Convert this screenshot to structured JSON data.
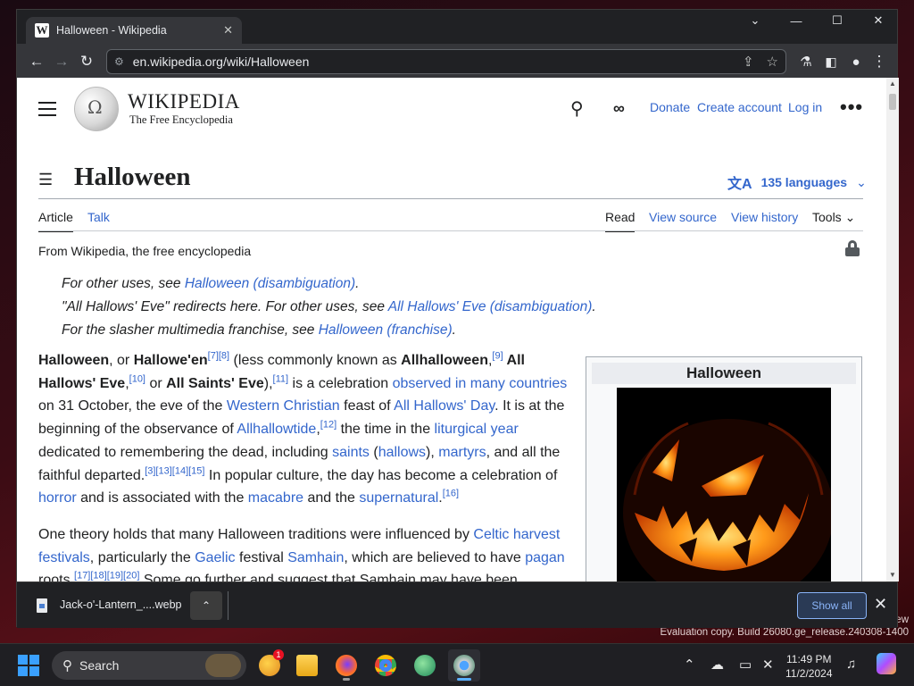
{
  "browser": {
    "tab_title": "Halloween - Wikipedia",
    "tab_close": "✕",
    "url": "en.wikipedia.org/wiki/Halloween",
    "window_controls": [
      "⌄",
      "—",
      "☐",
      "✕"
    ]
  },
  "wiki": {
    "wordmark": "WIKIPEDIA",
    "tagline": "The Free Encyclopedia",
    "donate": "Donate",
    "create_account": "Create account",
    "log_in": "Log in",
    "page_title": "Halloween",
    "languages": "135 languages",
    "tabs": {
      "article": "Article",
      "talk": "Talk",
      "read": "Read",
      "view_source": "View source",
      "view_history": "View history",
      "tools": "Tools"
    },
    "from_wikipedia": "From Wikipedia, the free encyclopedia",
    "hatnotes": [
      {
        "prefix": "For other uses, see ",
        "link": "Halloween (disambiguation)",
        "suffix": "."
      },
      {
        "prefix": "\"All Hallows' Eve\" redirects here. For other uses, see ",
        "link": "All Hallows' Eve (disambiguation)",
        "suffix": "."
      },
      {
        "prefix": "For the slasher multimedia franchise, see ",
        "link": "Halloween (franchise)",
        "suffix": "."
      }
    ],
    "infobox_title": "Halloween",
    "p1": {
      "t1": "Halloween",
      "t2": ", or ",
      "t3": "Hallowe'en",
      "s1": "[7][8]",
      "t4": " (less commonly known as ",
      "t5": "Allhalloween",
      "t6": ",",
      "s2": "[9]",
      "t7": " All Hallows' Eve",
      "t8": ",",
      "s3": "[10]",
      "t9": " or ",
      "t10": "All Saints' Eve",
      "t11": ")",
      "t12": ",",
      "s4": "[11]",
      "t13": " is a celebration ",
      "l1": "observed in many countries",
      "t14": " on 31 October, the eve of the ",
      "l2": "Western Christian",
      "t15": " feast of ",
      "l3": "All Hallows' Day",
      "t16": ". It is at the beginning of the observance of ",
      "l4": "Allhallowtide",
      "t17": ",",
      "s5": "[12]",
      "t18": " the time in the ",
      "l5": "liturgical year",
      "t19": " dedicated to remembering the dead, including ",
      "l6": "saints",
      "t20": " (",
      "l7": "hallows",
      "t21": "), ",
      "l8": "martyrs",
      "t22": ", and all the faithful departed.",
      "s6": "[3][13][14][15]",
      "t23": " In popular culture, the day has become a celebration of ",
      "l9": "horror",
      "t24": " and is associated with the ",
      "l10": "macabre",
      "t25": " and the ",
      "l11": "supernatural",
      "t26": ".",
      "s7": "[16]"
    },
    "p2": {
      "t1": "One theory holds that many Halloween traditions were influenced by ",
      "l1": "Celtic harvest festivals",
      "t2": ", particularly the ",
      "l2": "Gaelic",
      "t3": " festival ",
      "l3": "Samhain",
      "t4": ", which are believed to have ",
      "l4": "pagan",
      "t5": " roots.",
      "s1": "[17][18][19][20]",
      "t6": " Some go further and suggest that Samhain may have been"
    }
  },
  "download": {
    "file_name": "Jack-o'-Lantern_....webp",
    "show_all": "Show all"
  },
  "desktop": {
    "watermark_top": "ew",
    "watermark": "Evaluation copy. Build 26080.ge_release.240308-1400"
  },
  "taskbar": {
    "search_label": "Search",
    "notification_count": "1",
    "time": "11:49 PM",
    "date": "11/2/2024"
  },
  "colors": {
    "link": "#3366cc",
    "text": "#202122",
    "chrome_dark": "#202124",
    "accent": "#8ab4f8"
  }
}
